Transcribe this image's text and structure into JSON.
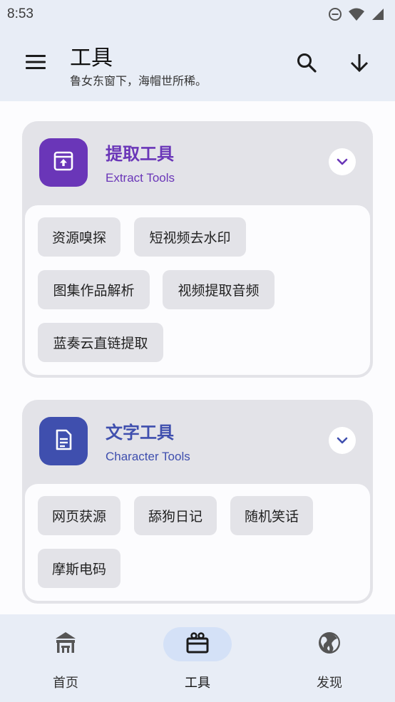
{
  "status_bar": {
    "time": "8:53",
    "icons": [
      "do-not-disturb-icon",
      "wifi-icon",
      "signal-icon"
    ]
  },
  "app_bar": {
    "title": "工具",
    "subtitle": "鲁女东窗下，海帽世所稀。",
    "icons": [
      "menu-icon",
      "search-icon",
      "download-arrow-icon"
    ]
  },
  "cards": [
    {
      "title": "提取工具",
      "subtitle": "Extract Tools",
      "accent": "#6a36b8",
      "icon": "archive-upload-icon",
      "chips": [
        "资源嗅探",
        "短视频去水印",
        "图集作品解析",
        "视频提取音频",
        "蓝奏云直链提取"
      ]
    },
    {
      "title": "文字工具",
      "subtitle": "Character Tools",
      "accent": "#3f4fae",
      "icon": "document-icon",
      "chips": [
        "网页获源",
        "舔狗日记",
        "随机笑话",
        "摩斯电码"
      ]
    }
  ],
  "bottom_nav": [
    {
      "label": "首页",
      "icon": "home-pavilion-icon",
      "active": false
    },
    {
      "label": "工具",
      "icon": "toolbox-icon",
      "active": true
    },
    {
      "label": "发现",
      "icon": "globe-icon",
      "active": false
    }
  ],
  "colors": {
    "app_bar_bg": "#e8edf6",
    "card_bg": "#e3e3e8",
    "active_nav": "#d4e1f7"
  }
}
